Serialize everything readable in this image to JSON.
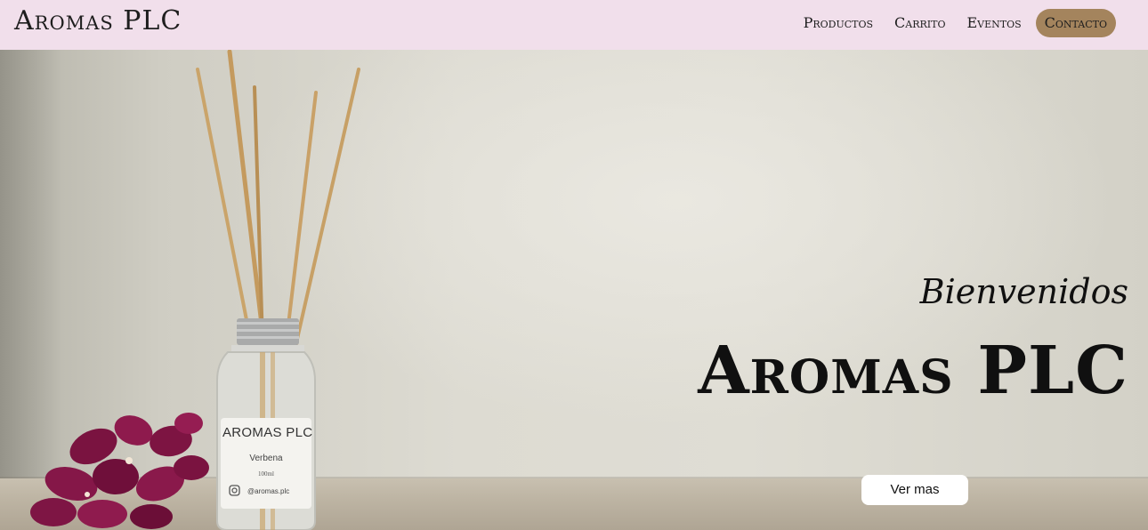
{
  "header": {
    "brand": "Aromas PLC",
    "nav": [
      {
        "label": "Productos"
      },
      {
        "label": "Carrito"
      },
      {
        "label": "Eventos"
      },
      {
        "label": "Contacto",
        "active": true
      }
    ],
    "background_color": "#f1dfeb",
    "active_color": "#a4845d"
  },
  "hero": {
    "welcome": "Bienvenidos",
    "title": "Aromas PLC",
    "cta_label": "Ver mas",
    "product_label": {
      "brand": "AROMAS PLC",
      "scent": "Verbena",
      "volume": "100ml",
      "handle": "@aromas.plc"
    },
    "icons": [
      "instagram-icon"
    ]
  }
}
